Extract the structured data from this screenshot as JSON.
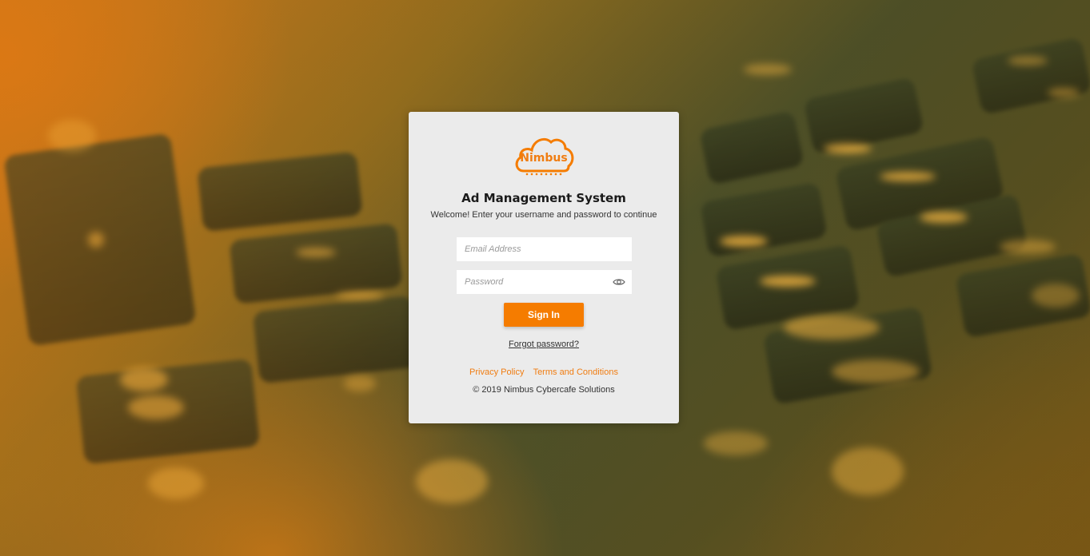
{
  "brand": {
    "logo_text": "Nimbus",
    "accent_color": "#f57c00",
    "logo_icon": "cloud-icon"
  },
  "login": {
    "title": "Ad Management System",
    "subtitle": "Welcome! Enter your username and password to continue",
    "email_placeholder": "Email Address",
    "email_value": "",
    "password_placeholder": "Password",
    "password_value": "",
    "show_password_icon": "eye-icon",
    "sign_in_label": "Sign In",
    "forgot_label": "Forgot password?"
  },
  "footer": {
    "privacy_label": "Privacy Policy",
    "terms_label": "Terms and Conditions",
    "copyright": "© 2019 Nimbus Cybercafe Solutions"
  }
}
